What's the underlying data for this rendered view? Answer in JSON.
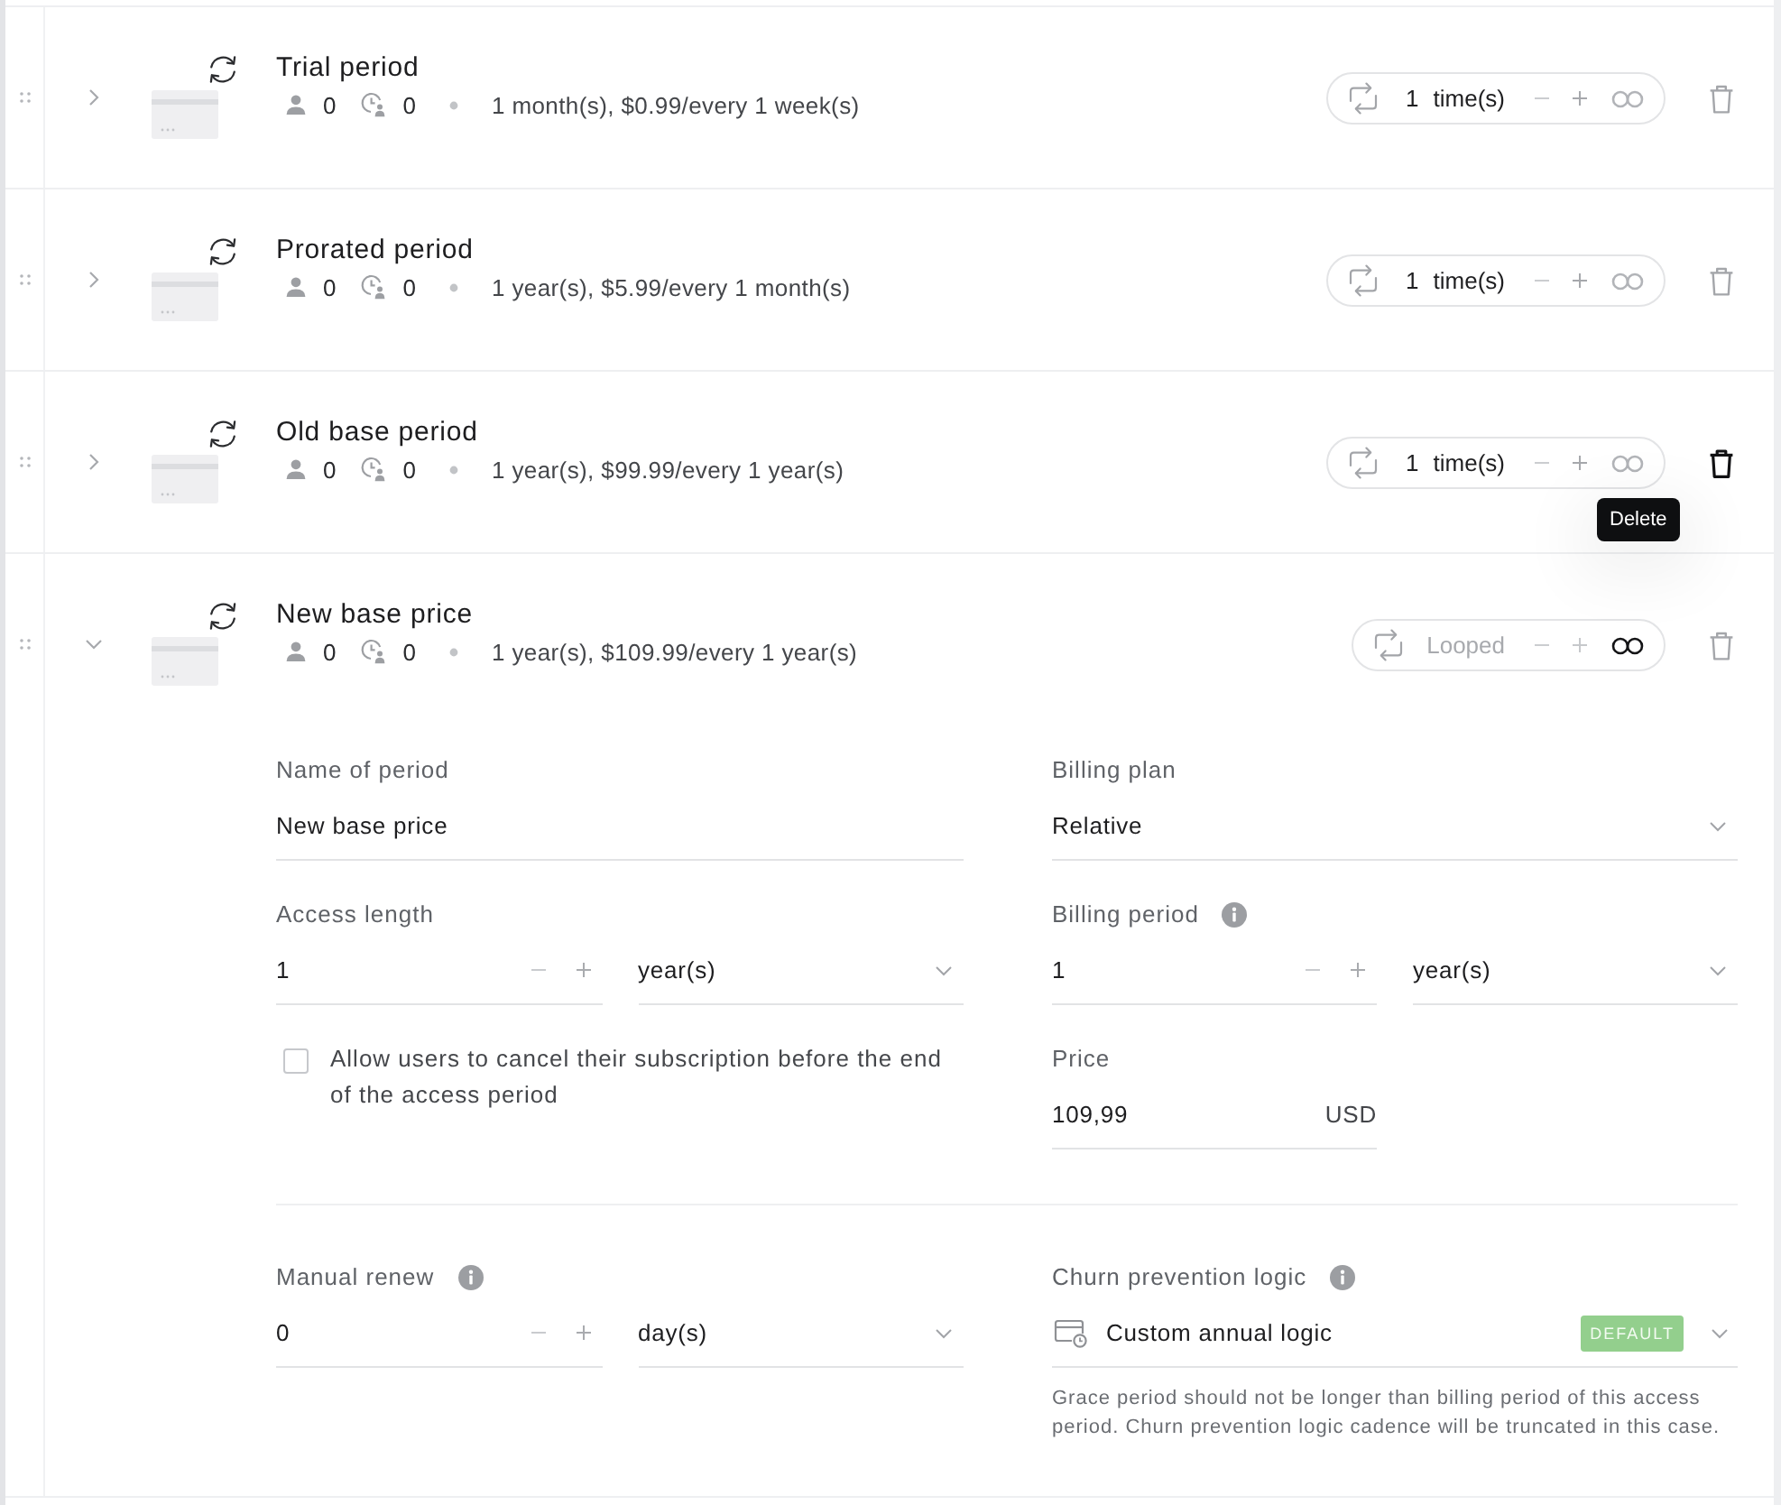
{
  "periods": [
    {
      "title": "Trial period",
      "subscribers": "0",
      "pending": "0",
      "summary": "1 month(s), $0.99/every 1 week(s)",
      "expanded": false,
      "repeat": {
        "count": "1",
        "unit": "time(s)",
        "looped": false
      },
      "delete_hovered": false
    },
    {
      "title": "Prorated period",
      "subscribers": "0",
      "pending": "0",
      "summary": "1 year(s), $5.99/every 1 month(s)",
      "expanded": false,
      "repeat": {
        "count": "1",
        "unit": "time(s)",
        "looped": false
      },
      "delete_hovered": false
    },
    {
      "title": "Old base period",
      "subscribers": "0",
      "pending": "0",
      "summary": "1 year(s), $99.99/every 1 year(s)",
      "expanded": false,
      "repeat": {
        "count": "1",
        "unit": "time(s)",
        "looped": false
      },
      "delete_hovered": true,
      "tooltip": "Delete"
    },
    {
      "title": "New base price",
      "subscribers": "0",
      "pending": "0",
      "summary": "1 year(s), $109.99/every 1 year(s)",
      "expanded": true,
      "repeat": {
        "label": "Looped",
        "looped": true
      },
      "delete_hovered": false,
      "form": {
        "name": {
          "label": "Name of period",
          "value": "New base price"
        },
        "billing_plan": {
          "label": "Billing plan",
          "value": "Relative"
        },
        "access_length": {
          "label": "Access length",
          "value": "1",
          "unit": "year(s)"
        },
        "billing_period": {
          "label": "Billing period",
          "info": true,
          "value": "1",
          "unit": "year(s)"
        },
        "cancel_option": {
          "label": "Allow users to cancel their subscription before the end of the access period",
          "checked": false
        },
        "price": {
          "label": "Price",
          "value": "109,99",
          "currency": "USD"
        },
        "manual_renew": {
          "label": "Manual renew",
          "info": true,
          "value": "0",
          "unit": "day(s)"
        },
        "churn_logic": {
          "label": "Churn prevention logic",
          "info": true,
          "value": "Custom annual logic",
          "badge": "DEFAULT",
          "note": "Grace period should not be longer than billing period of this access period. Churn prevention logic cadence will be truncated in this case."
        }
      }
    }
  ]
}
